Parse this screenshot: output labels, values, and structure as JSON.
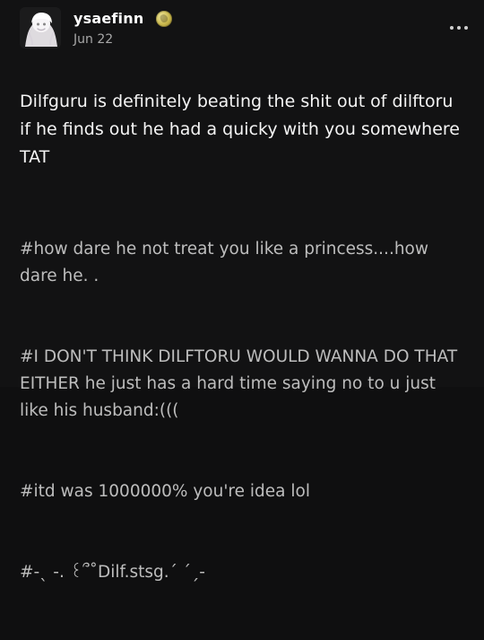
{
  "post": {
    "username": "ysaefinn",
    "date": "Jun 22",
    "main_text": "Dilfguru is definitely beating the shit out of dilftoru if he finds out he had a quicky with you somewhere TAT",
    "tags": [
      "#how dare he not treat you like a princess....how dare he. .",
      "#I DON'T THINK DILFTORU WOULD WANNA DO THAT EITHER he just has a hard time saying no to u just like his husband:(((",
      "#itd was 1000000% you're idea lol",
      "#-ˎ -. ꒰՞˚Dilf.stsg.ˊ ˊˏ-"
    ]
  },
  "icons": {
    "avatar": "avatar-image",
    "verified_badge": "gold-badge-icon",
    "more_menu": "more-horizontal-icon"
  },
  "colors": {
    "background": "#121213",
    "text": "#f4f4f4",
    "muted": "#a8a8a8",
    "tags": "#bdbdbd",
    "badge": "#c8b64b"
  }
}
